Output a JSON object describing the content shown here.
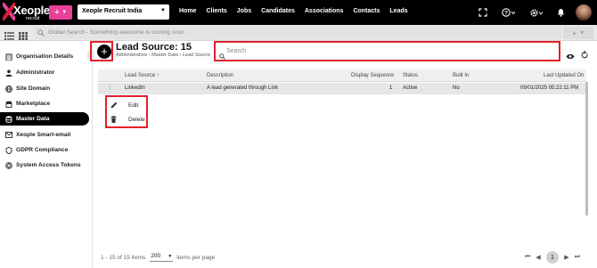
{
  "app": {
    "logo_text": "Xeople",
    "logo_sub": "recruit",
    "plus_label": "+",
    "company": "Xeople Recruit India",
    "nav": [
      "Home",
      "Clients",
      "Jobs",
      "Candidates",
      "Associations",
      "Contacts",
      "Leads"
    ],
    "global_search_placeholder": "Global Search - Something awesome is coming soon",
    "plus_dropdown_label": "+"
  },
  "sidebar": {
    "items": [
      {
        "label": "Organisation Details",
        "icon": "building-icon"
      },
      {
        "label": "Administrator",
        "icon": "person-icon"
      },
      {
        "label": "Site Domain",
        "icon": "globe-icon"
      },
      {
        "label": "Marketplace",
        "icon": "store-icon"
      },
      {
        "label": "Master Data",
        "icon": "database-icon",
        "active": true
      },
      {
        "label": "Xeople Smart-email",
        "icon": "envelope-icon"
      },
      {
        "label": "GDPR Compliance",
        "icon": "shield-icon"
      },
      {
        "label": "System Access Tokens",
        "icon": "key-icon"
      }
    ]
  },
  "page": {
    "title": "Lead Source: 15",
    "breadcrumb": [
      "Administrators",
      "Master Data",
      "Lead Source"
    ],
    "search_placeholder": "Search"
  },
  "table": {
    "columns": [
      "Lead Source",
      "Description",
      "Display Sequence",
      "Status",
      "Built In",
      "Last Updated On"
    ],
    "sort_indicator": "↑",
    "rows": [
      {
        "lead_source": "LinkedIn",
        "description": "A lead generated through Link",
        "display_sequence": "1",
        "status": "Active",
        "built_in": "No",
        "last_updated": "09/01/2025 05:22:11 PM"
      }
    ]
  },
  "context_menu": {
    "items": [
      {
        "label": "Edit",
        "icon": "pencil-icon"
      },
      {
        "label": "Delete",
        "icon": "trash-icon"
      }
    ]
  },
  "footer": {
    "range": "1 - 15 of 15 items",
    "per_page_value": "200",
    "per_page_label": "items per page",
    "current_page": "1"
  },
  "colors": {
    "accent_pink": "#e8409a",
    "highlight_red": "#e0202a",
    "topbar": "#000000"
  }
}
